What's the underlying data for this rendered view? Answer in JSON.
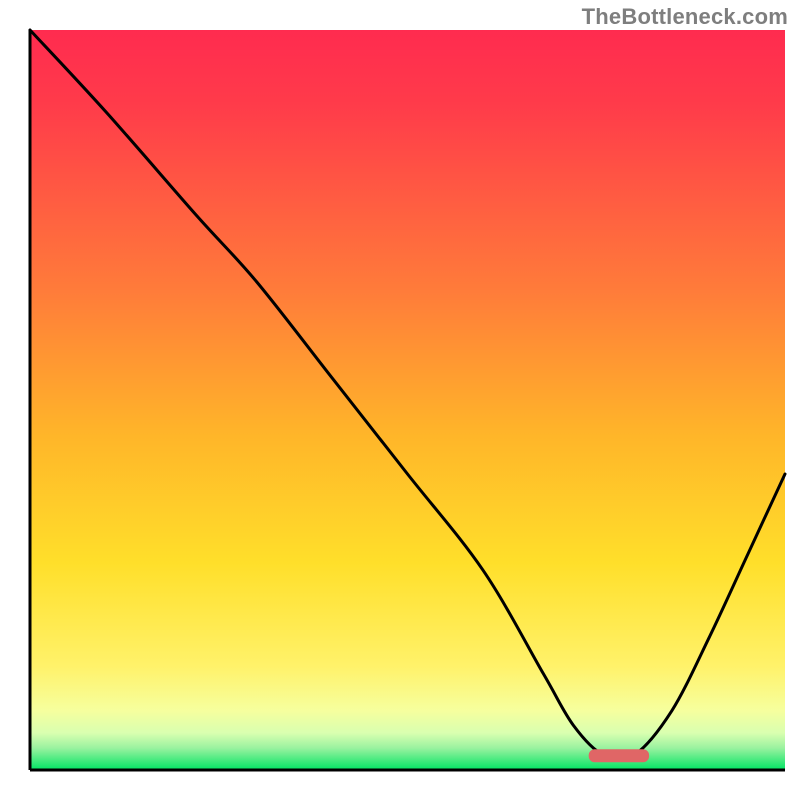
{
  "watermark": "TheBottleneck.com",
  "chart_data": {
    "type": "line",
    "title": "",
    "xlabel": "",
    "ylabel": "",
    "x_range": [
      0,
      100
    ],
    "y_range": [
      0,
      100
    ],
    "grid": false,
    "legend": false,
    "series": [
      {
        "name": "bottleneck-curve",
        "x": [
          0,
          10,
          22,
          30,
          40,
          50,
          60,
          68,
          72,
          76,
          80,
          85,
          90,
          95,
          100
        ],
        "y": [
          100,
          89,
          75,
          66,
          53,
          40,
          27,
          13,
          6,
          2,
          2,
          8,
          18,
          29,
          40
        ]
      }
    ],
    "marker": {
      "name": "optimal-range",
      "x_start": 74,
      "x_end": 82,
      "y": 2,
      "color": "#e06666"
    },
    "background_gradient": {
      "top_color": "#ff1744",
      "mid_color": "#ffd000",
      "near_bottom_color": "#fff176",
      "bottom_color": "#00e676"
    }
  }
}
